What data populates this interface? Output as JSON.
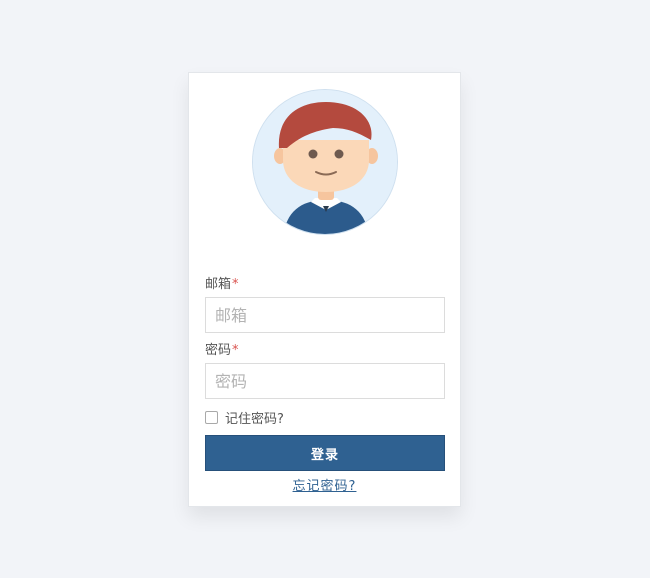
{
  "form": {
    "email": {
      "label": "邮箱",
      "required_mark": "*",
      "placeholder": "邮箱",
      "value": ""
    },
    "password": {
      "label": "密码",
      "required_mark": "*",
      "placeholder": "密码",
      "value": ""
    },
    "remember": {
      "label": "记住密码?",
      "checked": false
    },
    "login_button": "登录",
    "forgot_link": "忘记密码?"
  },
  "colors": {
    "page_background": "#f2f4f8",
    "primary": "#2f6191",
    "required": "#d9534f",
    "avatar_background": "#e3f0fb",
    "hair": "#b44a3e",
    "shirt": "#2c5b8c"
  },
  "icons": {
    "avatar": "user-avatar-illustration"
  }
}
